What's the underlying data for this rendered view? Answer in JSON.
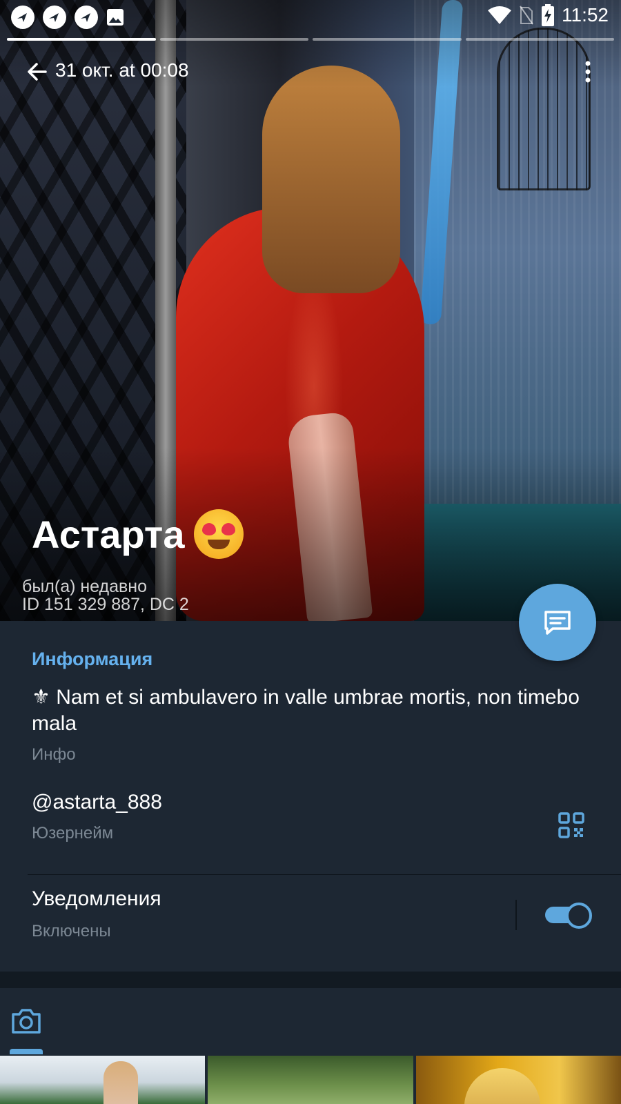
{
  "status_bar": {
    "time": "11:52",
    "icons": [
      "app-notification-icon",
      "app-notification-icon",
      "app-notification-icon",
      "gallery-icon",
      "wifi-icon",
      "no-sim-icon",
      "battery-charging-icon"
    ]
  },
  "stories": {
    "count": 4,
    "active_index": 0
  },
  "top_bar": {
    "title": "31 окт. at 00:08",
    "back_icon": "arrow-left-icon",
    "menu_icon": "more-vertical-icon"
  },
  "profile": {
    "name_prefix": "",
    "name": "Астарта",
    "name_suffix": "",
    "name_emoji": "heart-eyes-emoji-icon",
    "last_seen": "был(а) недавно",
    "id_line": "ID 151 329 887, DC 2"
  },
  "fab": {
    "icon": "message-icon"
  },
  "info": {
    "section_title": "Информация",
    "bio_symbol": "⚜",
    "bio": "Nam et si ambulavero in valle umbrae mortis, non timebo mala",
    "bio_tail": "",
    "bio_label": "Инфо",
    "username": "@astarta_888",
    "username_label": "Юзернейм",
    "qr_icon": "qr-code-icon",
    "notifications": "Уведомления",
    "notifications_state": "Включены",
    "notifications_on": true
  },
  "media": {
    "tab_icon": "camera-icon",
    "thumbnails": [
      "photo-1",
      "photo-2",
      "photo-3"
    ]
  },
  "colors": {
    "accent": "#5ea7dd",
    "section_title": "#65b1ee",
    "background": "#1d2733",
    "secondary_text": "#7c8894"
  }
}
